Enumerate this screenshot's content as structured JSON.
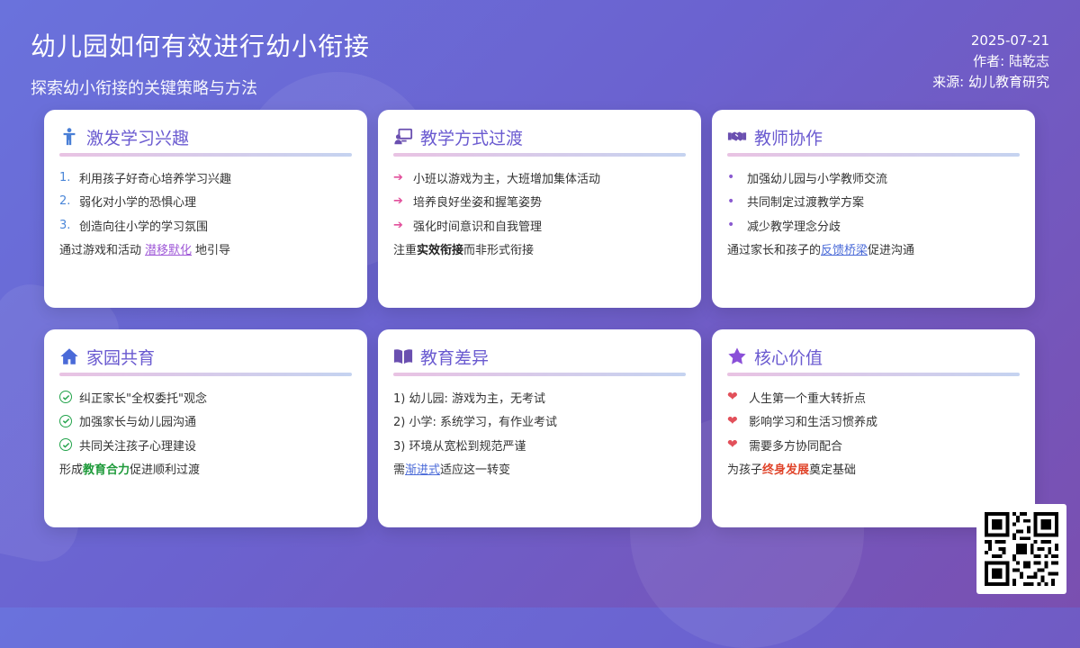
{
  "header": {
    "title": "幼儿园如何有效进行幼小衔接",
    "subtitle": "探索幼小衔接的关键策略与方法"
  },
  "meta": {
    "date": "2025-07-21",
    "author": "作者: 陆乾志",
    "source": "来源: 幼儿教育研究"
  },
  "cards": [
    {
      "title": "激发学习兴趣",
      "icon": "child-icon",
      "items": [
        "利用孩子好奇心培养学习兴趣",
        "弱化对小学的恐惧心理",
        "创造向往小学的学习氛围"
      ],
      "markers": [
        "1.",
        "2.",
        "3."
      ],
      "note": {
        "before": "通过游戏和活动",
        "highlight": "潜移默化",
        "after": "地引导"
      }
    },
    {
      "title": "教学方式过渡",
      "icon": "teacher-board-icon",
      "items": [
        "小班以游戏为主，大班增加集体活动",
        "培养良好坐姿和握笔姿势",
        "强化时间意识和自我管理"
      ],
      "markers": [
        "➔",
        "➔",
        "➔"
      ],
      "note": {
        "before": "注重",
        "highlight": "实效衔接",
        "after": "而非形式衔接"
      }
    },
    {
      "title": "教师协作",
      "icon": "handshake-icon",
      "items": [
        "加强幼儿园与小学教师交流",
        "共同制定过渡教学方案",
        "减少教学理念分歧"
      ],
      "markers": [
        "•",
        "•",
        "•"
      ],
      "note": {
        "before": "通过家长和孩子的",
        "highlight": "反馈桥梁",
        "after": "促进沟通"
      }
    },
    {
      "title": "家园共育",
      "icon": "home-icon",
      "items": [
        "纠正家长\"全权委托\"观念",
        "加强家长与幼儿园沟通",
        "共同关注孩子心理建设"
      ],
      "note": {
        "before": "形成",
        "highlight": "教育合力",
        "after": "促进顺利过渡"
      }
    },
    {
      "title": "教育差异",
      "icon": "book-icon",
      "items": [
        "1) 幼儿园: 游戏为主，无考试",
        "2) 小学: 系统学习，有作业考试",
        "3) 环境从宽松到规范严谨"
      ],
      "note": {
        "before": "需",
        "highlight": "渐进式",
        "after": "适应这一转变"
      }
    },
    {
      "title": "核心价值",
      "icon": "star-icon",
      "items": [
        "人生第一个重大转折点",
        "影响学习和生活习惯养成",
        "需要多方协同配合"
      ],
      "note": {
        "before": "为孩子",
        "highlight": "终身发展",
        "after": "奠定基础"
      }
    }
  ],
  "colors": {
    "accent": "#6a5ad0",
    "background_start": "#6a72dc",
    "background_end": "#7a4fb0"
  }
}
